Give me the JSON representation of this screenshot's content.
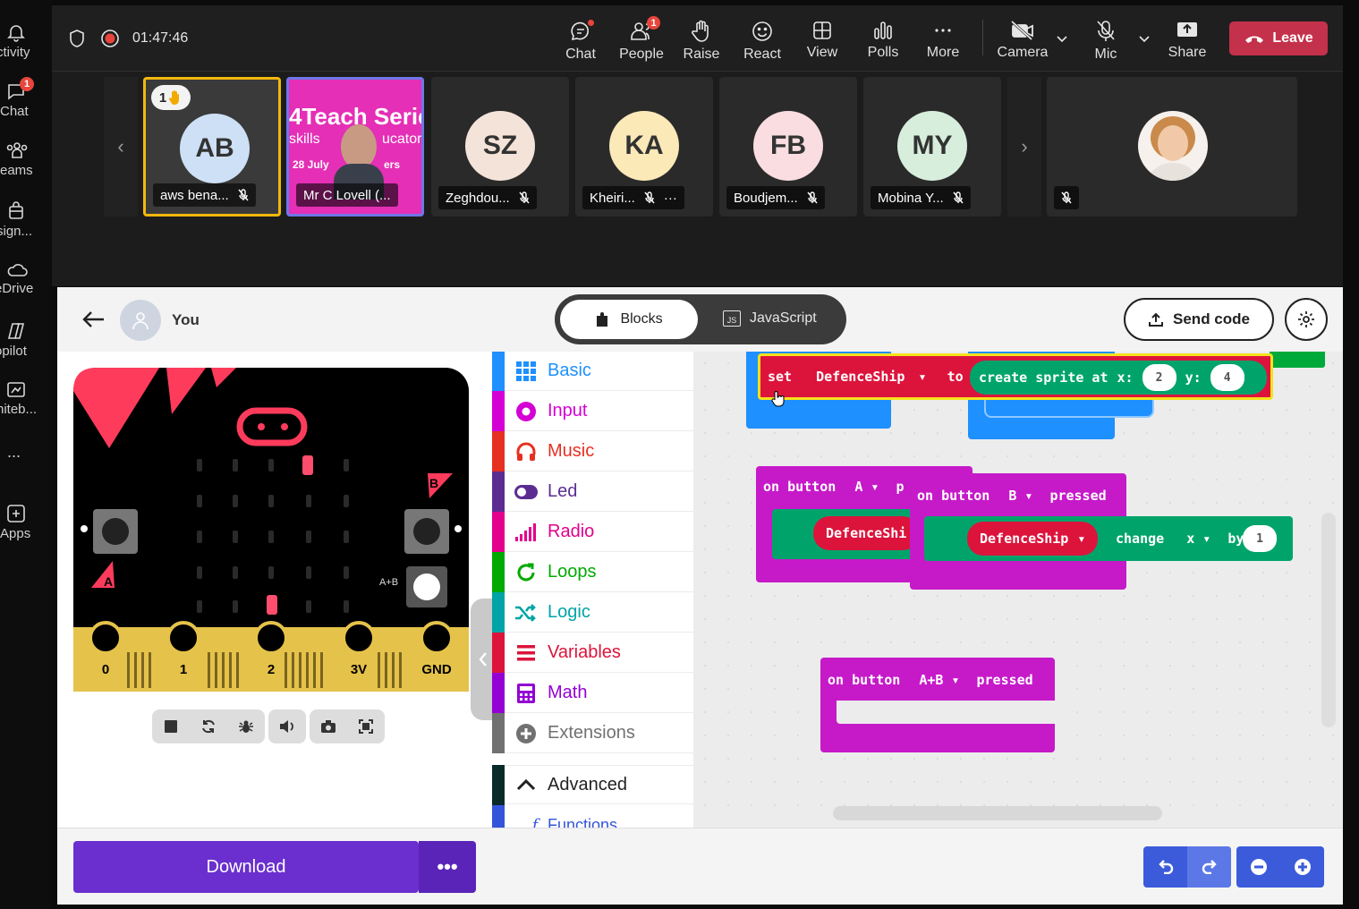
{
  "rail": {
    "items": [
      {
        "label": "ctivity",
        "badge": ""
      },
      {
        "label": "Chat",
        "badge": "1"
      },
      {
        "label": "eams",
        "badge": ""
      },
      {
        "label": "sign...",
        "badge": ""
      },
      {
        "label": "eDrive",
        "badge": ""
      },
      {
        "label": "opilot",
        "badge": ""
      },
      {
        "label": "hiteb...",
        "badge": ""
      },
      {
        "label": "...",
        "badge": ""
      },
      {
        "label": "Apps",
        "badge": ""
      }
    ]
  },
  "meeting": {
    "timer": "01:47:46",
    "toolbar": {
      "chat": "Chat",
      "people": "People",
      "people_badge": "1",
      "raise": "Raise",
      "react": "React",
      "view": "View",
      "polls": "Polls",
      "more": "More",
      "camera": "Camera",
      "mic": "Mic",
      "share": "Share",
      "leave": "Leave"
    },
    "participants": [
      {
        "initials": "AB",
        "name": "aws bena...",
        "hand": "1",
        "color": "#cde0f5"
      },
      {
        "initials": "",
        "name": "Mr C Lovell (...",
        "banner": "4Teach Serie",
        "banner2": "skills",
        "banner3": "ucator",
        "date": "28 July",
        "tail": "ers"
      },
      {
        "initials": "SZ",
        "name": "Zeghdou...",
        "color": "#f4e3d9"
      },
      {
        "initials": "KA",
        "name": "Kheiri...",
        "color": "#fbe9b8",
        "more": "···"
      },
      {
        "initials": "FB",
        "name": "Boudjem...",
        "color": "#f9dde0"
      },
      {
        "initials": "MY",
        "name": "Mobina Y...",
        "color": "#d8eedd"
      },
      {
        "initials": "",
        "name": ""
      }
    ]
  },
  "editor": {
    "user": "You",
    "tabs": {
      "blocks": "Blocks",
      "javascript": "JavaScript",
      "js_badge": "JS"
    },
    "send_code": "Send code",
    "board_labels": {
      "btn_a": "A",
      "btn_b": "B",
      "ab": "A+B",
      "pins": [
        "0",
        "1",
        "2",
        "3V",
        "GND"
      ]
    },
    "toolbox": [
      {
        "label": "Basic",
        "color": "#1e90ff"
      },
      {
        "label": "Input",
        "color": "#d400d4"
      },
      {
        "label": "Music",
        "color": "#e63022"
      },
      {
        "label": "Led",
        "color": "#5c2d91"
      },
      {
        "label": "Radio",
        "color": "#e3008c"
      },
      {
        "label": "Loops",
        "color": "#00aa00"
      },
      {
        "label": "Logic",
        "color": "#00a4a6"
      },
      {
        "label": "Variables",
        "color": "#dc143c"
      },
      {
        "label": "Math",
        "color": "#9400d3"
      },
      {
        "label": "Extensions",
        "color": "#717171"
      },
      {
        "label": "Advanced",
        "color": "#222222"
      },
      {
        "label": "Functions",
        "color": "#3455db"
      }
    ],
    "blocks": {
      "set_block": {
        "kw": "set",
        "var": "DefenceShip",
        "to": "to",
        "create": "create sprite at",
        "x": "x:",
        "xv": "2",
        "y": "y:",
        "yv": "4"
      },
      "btn_a": {
        "text": "on button",
        "btn": "A",
        "trail": "p",
        "var": "DefenceShi"
      },
      "btn_b": {
        "text": "on button",
        "btn": "B",
        "pressed": "pressed",
        "var": "DefenceShip",
        "change": "change",
        "axis": "x",
        "by": "by",
        "val": "1"
      },
      "btn_ab": {
        "text": "on button",
        "btn": "A+B",
        "pressed": "pressed"
      }
    },
    "download": "Download",
    "download_more": "•••"
  }
}
